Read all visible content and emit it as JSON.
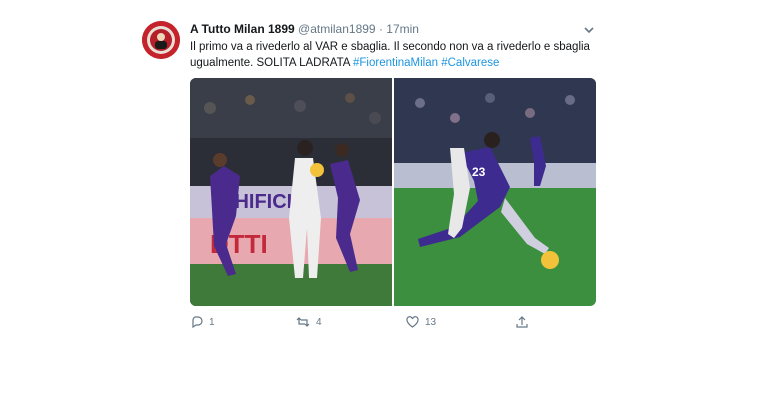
{
  "tweet": {
    "author_name": "A Tutto Milan 1899",
    "handle": "@atmilan1899",
    "separator": "·",
    "time": "17min",
    "text_plain": "Il primo va a rivederlo al VAR e sbaglia. Il secondo non va a rivederlo e sbaglia ugualmente. SOLITA LADRATA",
    "hashtags": [
      "#FiorentinaMilan",
      "#Calvarese"
    ],
    "banner_text": "CHIFICIO",
    "banner_text_2": "DTTI",
    "player_number": "23"
  },
  "actions": {
    "reply_count": "1",
    "retweet_count": "4",
    "like_count": "13"
  },
  "colors": {
    "link": "#1b95e0",
    "muted": "#657786",
    "fiorentina_purple": "#4a2a8c",
    "pitch_green": "#3b8f3e"
  },
  "icons": [
    "chevron-down-icon",
    "reply-icon",
    "retweet-icon",
    "like-icon",
    "share-icon"
  ]
}
